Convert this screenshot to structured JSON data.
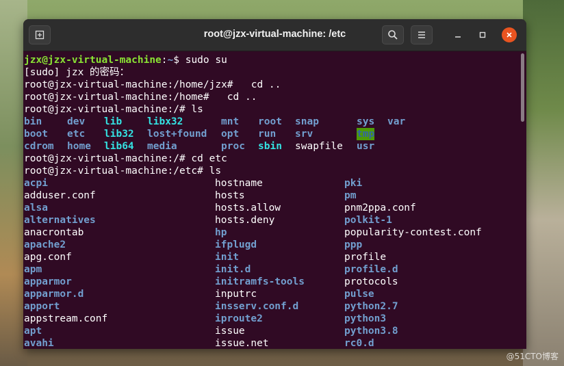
{
  "window": {
    "title": "root@jzx-virtual-machine: /etc"
  },
  "icons": {
    "new_tab": "new-tab-icon",
    "search": "search-icon",
    "menu": "hamburger-menu-icon",
    "minimize": "minimize-icon",
    "maximize": "maximize-icon",
    "close": "close-icon"
  },
  "terminal": {
    "line1": {
      "user": "jzx@jzx-virtual-machine",
      "colon": ":",
      "path": "~",
      "cmd": "$ sudo su"
    },
    "line2": "[sudo] jzx 的密码：",
    "line3": "root@jzx-virtual-machine:/home/jzx#   cd ..",
    "line4": "root@jzx-virtual-machine:/home#   cd ..",
    "line5": "root@jzx-virtual-machine:/# ls",
    "ls_root": [
      [
        "bin",
        "dev",
        "lib",
        "libx32",
        "mnt",
        "root",
        "snap",
        "sys",
        "var"
      ],
      [
        "boot",
        "etc",
        "lib32",
        "lost+found",
        "opt",
        "run",
        "srv",
        "tmp"
      ],
      [
        "cdrom",
        "home",
        "lib64",
        "media",
        "proc",
        "sbin",
        "swapfile",
        "usr"
      ]
    ],
    "line9": "root@jzx-virtual-machine:/# cd etc",
    "line10": "root@jzx-virtual-machine:/etc# ls",
    "ls_etc": [
      [
        "acpi",
        "hostname",
        "pki"
      ],
      [
        "adduser.conf",
        "hosts",
        "pm"
      ],
      [
        "alsa",
        "hosts.allow",
        "pnm2ppa.conf"
      ],
      [
        "alternatives",
        "hosts.deny",
        "polkit-1"
      ],
      [
        "anacrontab",
        "hp",
        "popularity-contest.conf"
      ],
      [
        "apache2",
        "ifplugd",
        "ppp"
      ],
      [
        "apg.conf",
        "init",
        "profile"
      ],
      [
        "apm",
        "init.d",
        "profile.d"
      ],
      [
        "apparmor",
        "initramfs-tools",
        "protocols"
      ],
      [
        "apparmor.d",
        "inputrc",
        "pulse"
      ],
      [
        "apport",
        "insserv.conf.d",
        "python2.7"
      ],
      [
        "appstream.conf",
        "iproute2",
        "python3"
      ],
      [
        "apt",
        "issue",
        "python3.8"
      ],
      [
        "avahi",
        "issue.net",
        "rc0.d"
      ]
    ]
  },
  "watermark": "@51CTO博客"
}
